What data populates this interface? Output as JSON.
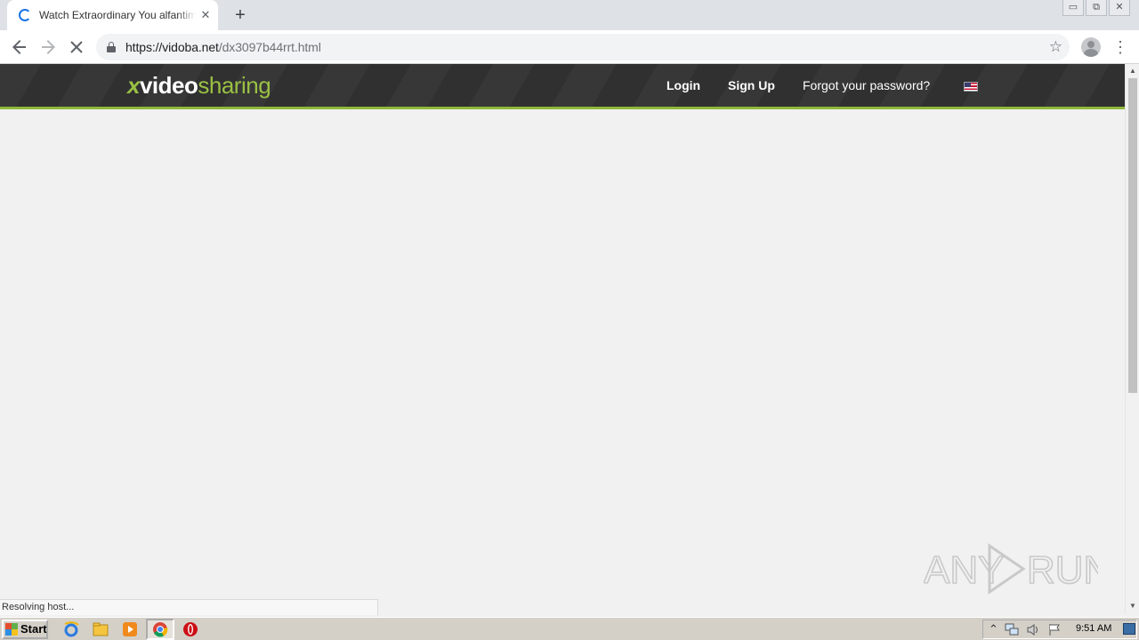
{
  "browser": {
    "tab_title": "Watch Extraordinary You alfantime m",
    "tab_close": "✕",
    "new_tab": "+",
    "url_host": "https://vidoba.net",
    "url_path": "/dx3097b44rrt.html",
    "status_text": "Resolving host...",
    "window_buttons": [
      "▭",
      "⧉",
      "✕"
    ],
    "icons": [
      "back-icon",
      "forward-icon",
      "stop-icon",
      "lock-icon",
      "star-icon",
      "profile-icon",
      "menu-icon"
    ]
  },
  "site": {
    "logo_x": "x",
    "logo_video": "video",
    "logo_sharing": "sharing",
    "nav": {
      "login": "Login",
      "signup": "Sign Up",
      "forgot": "Forgot your password?"
    },
    "accent_color": "#9ac043",
    "header_color": "#333333"
  },
  "watermark": {
    "left": "ANY",
    "right": "RUN"
  },
  "taskbar": {
    "start_label": "Start",
    "clock": "9:51 AM",
    "tray_icons": [
      "arrow-up-icon",
      "network-icon",
      "volume-icon",
      "flag-icon"
    ],
    "quicklaunch_icons": [
      "ie-icon",
      "explorer-icon",
      "media-player-icon",
      "chrome-icon",
      "opera-icon"
    ]
  }
}
